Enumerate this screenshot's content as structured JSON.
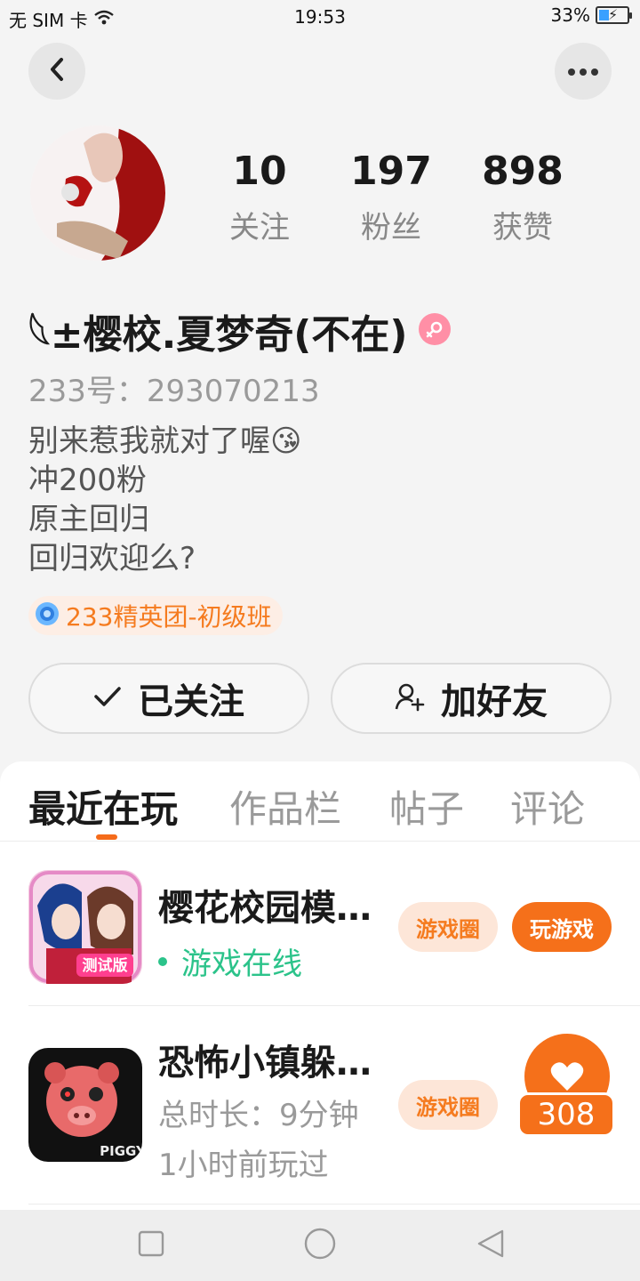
{
  "status_bar": {
    "carrier": "无 SIM 卡",
    "time": "19:53",
    "battery": "33%",
    "battery_level": 0.33
  },
  "header": {
    "back_icon": "chevron-left-icon",
    "more_icon": "more-dots-icon"
  },
  "profile": {
    "stats": [
      {
        "value": "10",
        "label": "关注"
      },
      {
        "value": "197",
        "label": "粉丝"
      },
      {
        "value": "898",
        "label": "获赞"
      }
    ],
    "username": "𓆩±樱校.夏梦奇(不在)",
    "gender_icon": "female-icon",
    "id_line": "233号：293070213",
    "bio_lines": [
      "别来惹我就对了喔😘",
      "冲200粉",
      "原主回归",
      "回归欢迎么?"
    ],
    "badge": "233精英团-初级班"
  },
  "actions": {
    "follow_label": "已关注",
    "add_friend_label": "加好友"
  },
  "tabs": [
    {
      "label": "最近在玩",
      "active": true
    },
    {
      "label": "作品栏",
      "active": false
    },
    {
      "label": "帖子",
      "active": false
    },
    {
      "label": "评论",
      "active": false
    }
  ],
  "games": [
    {
      "title": "樱花校园模…",
      "status": "游戏在线",
      "circle_label": "游戏圈",
      "play_label": "玩游戏",
      "icon_badge": "测试版"
    },
    {
      "title": "恐怖小镇躲…",
      "duration": "总时长：9分钟",
      "last_played": "1小时前玩过",
      "circle_label": "游戏圈",
      "icon_badge": "PIGGY"
    }
  ],
  "like_float": {
    "count": "308"
  },
  "colors": {
    "accent": "#f5701a",
    "online": "#2bc38a",
    "badge_text": "#f57b1f"
  }
}
